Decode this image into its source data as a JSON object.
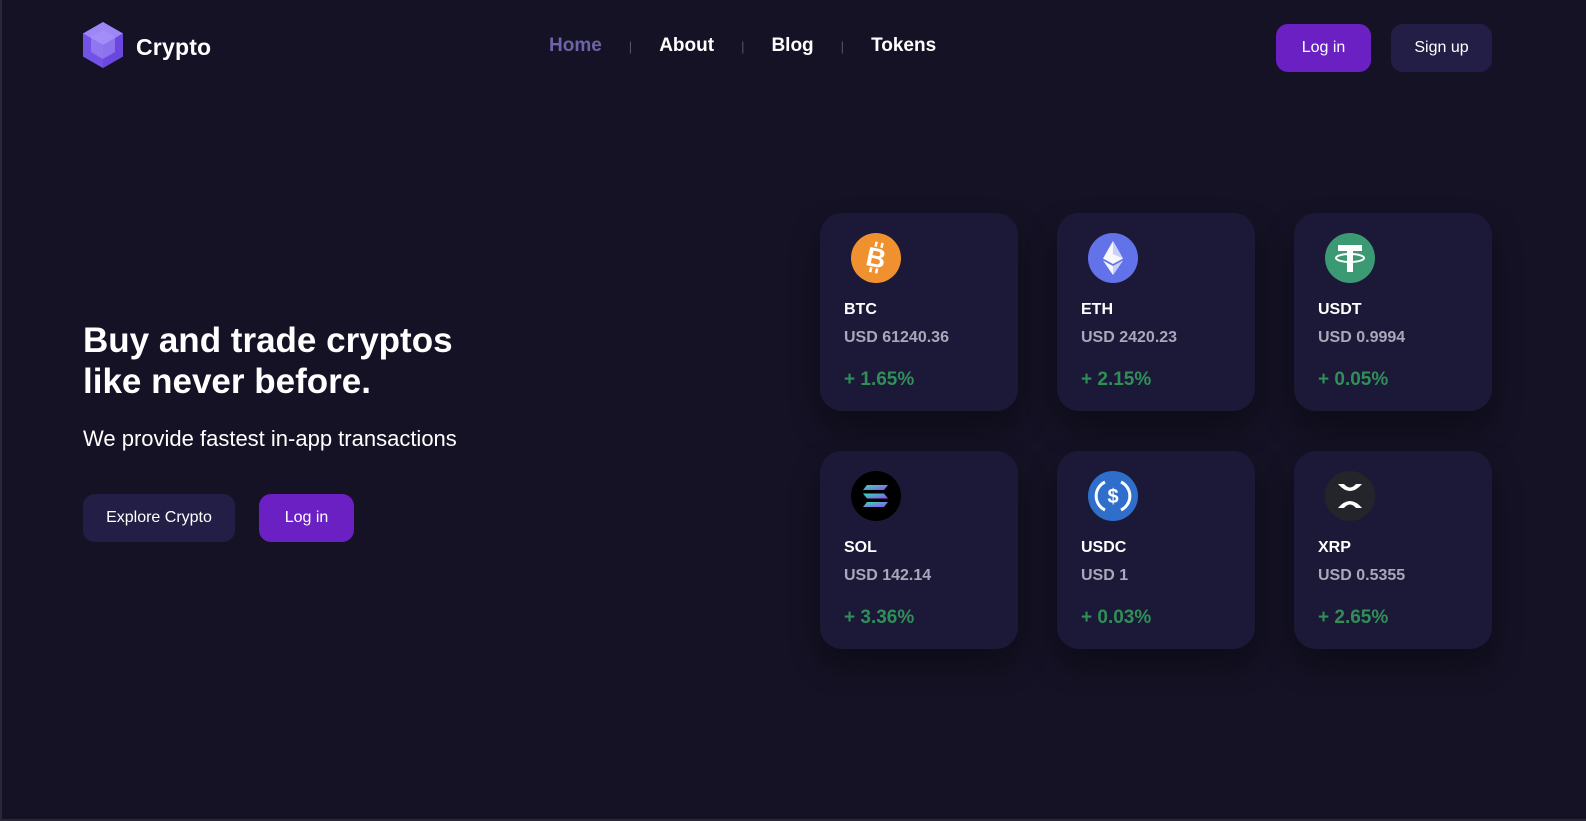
{
  "header": {
    "logo_text": "Crypto",
    "nav": [
      {
        "label": "Home",
        "active": true
      },
      {
        "label": "About",
        "active": false
      },
      {
        "label": "Blog",
        "active": false
      },
      {
        "label": "Tokens",
        "active": false
      }
    ],
    "login_label": "Log in",
    "signup_label": "Sign up"
  },
  "hero": {
    "title_line1": "Buy and trade cryptos",
    "title_line2": "like never before.",
    "subtitle": "We provide fastest in-app transactions",
    "explore_label": "Explore Crypto",
    "login_label": "Log in"
  },
  "coins": [
    {
      "symbol": "BTC",
      "price": "USD 61240.36",
      "change": "+ 1.65%",
      "icon": "bitcoin-icon",
      "color": "#f0912f"
    },
    {
      "symbol": "ETH",
      "price": "USD 2420.23",
      "change": "+ 2.15%",
      "icon": "ethereum-icon",
      "color": "#6272e8"
    },
    {
      "symbol": "USDT",
      "price": "USD 0.9994",
      "change": "+ 0.05%",
      "icon": "tether-icon",
      "color": "#3b9a74"
    },
    {
      "symbol": "SOL",
      "price": "USD 142.14",
      "change": "+ 3.36%",
      "icon": "solana-icon",
      "color": "#000000"
    },
    {
      "symbol": "USDC",
      "price": "USD 1",
      "change": "+ 0.03%",
      "icon": "usdc-icon",
      "color": "#2f6fcb"
    },
    {
      "symbol": "XRP",
      "price": "USD 0.5355",
      "change": "+ 2.65%",
      "icon": "xrp-icon",
      "color": "#23252a"
    }
  ],
  "colors": {
    "background": "#141224",
    "card": "#1c1938",
    "primary": "#6a20c2",
    "secondary": "#231e45",
    "positive": "#2f8f57",
    "nav_active": "#6b64a8"
  }
}
